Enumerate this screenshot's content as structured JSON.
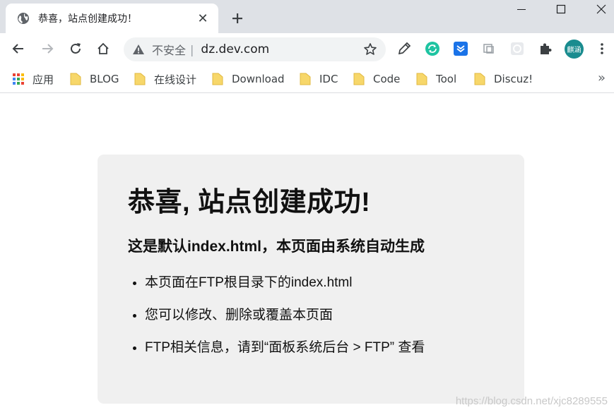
{
  "tab": {
    "title": "恭喜，站点创建成功！",
    "close_glyph": "✕"
  },
  "toolbar": {
    "security_label": "不安全",
    "separator": "|",
    "url": "dz.dev.com"
  },
  "profile": {
    "avatar_text": "麒涵",
    "avatar_color": "#1a8c8f"
  },
  "bookmarks": {
    "apps_label": "应用",
    "items": [
      "BLOG",
      "在线设计",
      "Download",
      "IDC",
      "Code",
      "Tool",
      "Discuz!"
    ],
    "more_glyph": "»"
  },
  "page": {
    "heading": "恭喜, 站点创建成功!",
    "subheading": "这是默认index.html，本页面由系统自动生成",
    "list": [
      "本页面在FTP根目录下的index.html",
      "您可以修改、删除或覆盖本页面",
      "FTP相关信息，请到“面板系统后台 > FTP” 查看"
    ]
  },
  "watermark": "https://blog.csdn.net/xjc8289555",
  "colors": {
    "tabstrip_bg": "#dee1e6",
    "card_bg": "#f0f0f0",
    "folder_yellow": "#f7d76a"
  }
}
